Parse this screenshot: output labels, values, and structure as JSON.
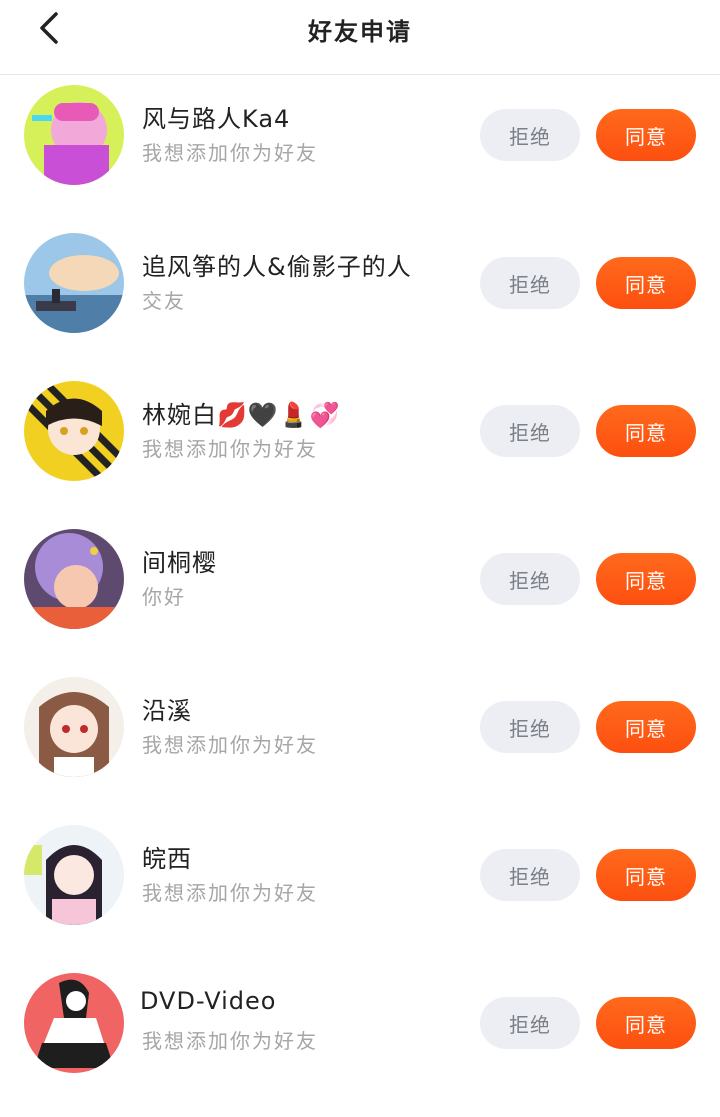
{
  "header": {
    "title": "好友申请",
    "back_icon": "chevron-left-icon"
  },
  "colors": {
    "accept": "#fd5a14",
    "reject_bg": "#eceef3",
    "secondary_text": "#a6a6a6"
  },
  "requests": [
    {
      "name": "风与路人Ka4",
      "message": "我想添加你为好友",
      "reject_label": "拒绝",
      "accept_label": "同意"
    },
    {
      "name": "追风筝的人&偷影子的人",
      "message": "交友",
      "reject_label": "拒绝",
      "accept_label": "同意"
    },
    {
      "name": "林婉白💋🖤💄💞",
      "message": "我想添加你为好友",
      "reject_label": "拒绝",
      "accept_label": "同意"
    },
    {
      "name": "间桐樱",
      "message": "你好",
      "reject_label": "拒绝",
      "accept_label": "同意"
    },
    {
      "name": "沿溪",
      "message": "我想添加你为好友",
      "reject_label": "拒绝",
      "accept_label": "同意"
    },
    {
      "name": "皖西",
      "message": "我想添加你为好友",
      "reject_label": "拒绝",
      "accept_label": "同意"
    },
    {
      "name": "DVD-Video",
      "message": "我想添加你为好友",
      "reject_label": "拒绝",
      "accept_label": "同意"
    }
  ]
}
